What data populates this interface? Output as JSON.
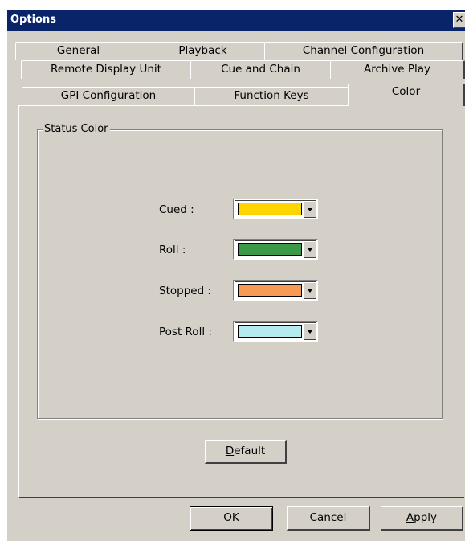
{
  "window": {
    "title": "Options",
    "close_glyph": "✕"
  },
  "tabs": {
    "row1": [
      "General",
      "Playback",
      "Channel Configuration"
    ],
    "row2": [
      "Remote Display Unit",
      "Cue and Chain",
      "Archive Play"
    ],
    "row3": [
      "GPI Configuration",
      "Function Keys",
      "Color"
    ],
    "active": "Color"
  },
  "status_color": {
    "group_title": "Status Color",
    "items": [
      {
        "label": "Cued :",
        "color": "#ffd500"
      },
      {
        "label": "Roll :",
        "color": "#3a9a48"
      },
      {
        "label": "Stopped :",
        "color": "#f79a56"
      },
      {
        "label": "Post Roll :",
        "color": "#b4ebee"
      }
    ]
  },
  "buttons": {
    "default": {
      "mnemonic": "D",
      "rest": "efault"
    },
    "ok": "OK",
    "cancel": "Cancel",
    "apply": {
      "mnemonic": "A",
      "rest": "pply"
    }
  }
}
